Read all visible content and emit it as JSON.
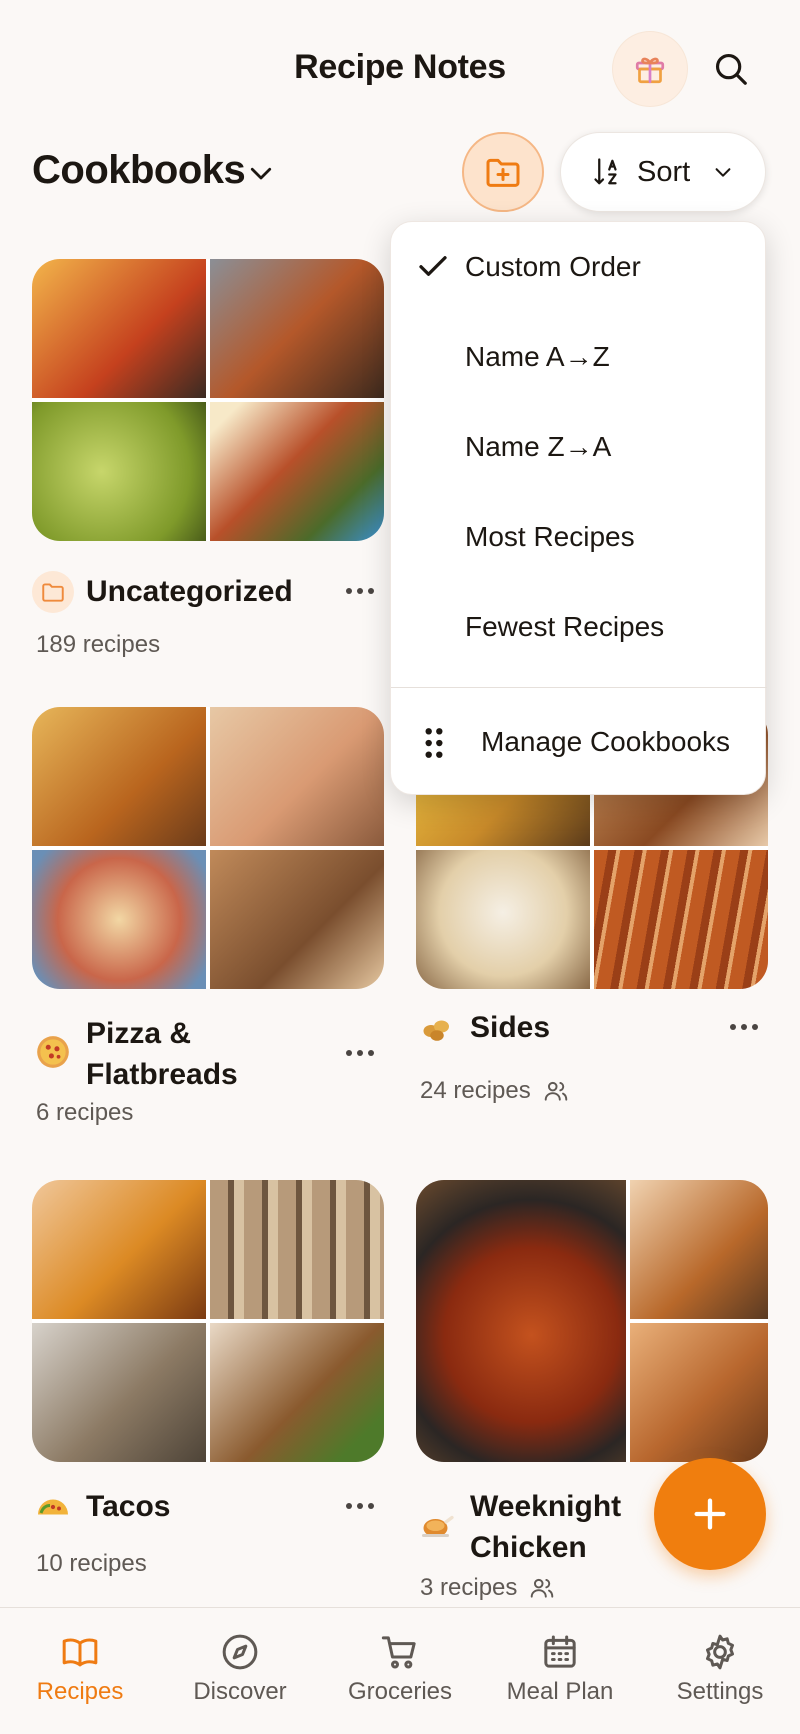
{
  "header": {
    "title": "Recipe Notes",
    "gift_icon": "gift-icon",
    "search_icon": "search-icon"
  },
  "section": {
    "title": "Cookbooks",
    "sort_label": "Sort"
  },
  "sort_menu": {
    "items": [
      {
        "label": "Custom Order",
        "selected": true
      },
      {
        "label": "Name A→Z",
        "selected": false
      },
      {
        "label": "Name Z→A",
        "selected": false
      },
      {
        "label": "Most Recipes",
        "selected": false
      },
      {
        "label": "Fewest Recipes",
        "selected": false
      }
    ],
    "manage_label": "Manage Cookbooks"
  },
  "cookbooks": [
    {
      "name": "Uncategorized",
      "count": "189 recipes",
      "icon": "folder-icon",
      "shared": false,
      "tiles": [
        "#c06a2a",
        "#7a5a3c",
        "#9fb33c",
        "#b8502a"
      ]
    },
    {
      "name": "Pizza & Flatbreads",
      "count": "6 recipes",
      "icon": "pizza-icon",
      "shared": false,
      "tiles": [
        "#c98a2c",
        "#d9a377",
        "#c9664a",
        "#b98555"
      ]
    },
    {
      "name": "Sides",
      "count": "24 recipes",
      "icon": "nuts-icon",
      "shared": true,
      "tiles": [
        "#e3b043",
        "#b3763c",
        "#e9ddc9",
        "#b6552a"
      ]
    },
    {
      "name": "Tacos",
      "count": "10 recipes",
      "icon": "taco-icon",
      "shared": false,
      "tiles": [
        "#d6842a",
        "#8c7055",
        "#9b8a77",
        "#a66a2e"
      ]
    },
    {
      "name": "Weeknight Chicken",
      "count": "3 recipes",
      "icon": "chicken-icon",
      "shared": true,
      "tiles": [
        "#b3491e",
        "#c98a55",
        "#3b302a",
        "#b86a36"
      ]
    }
  ],
  "tabs": [
    {
      "label": "Recipes",
      "icon": "book-icon",
      "active": true
    },
    {
      "label": "Discover",
      "icon": "compass-icon",
      "active": false
    },
    {
      "label": "Groceries",
      "icon": "cart-icon",
      "active": false
    },
    {
      "label": "Meal Plan",
      "icon": "calendar-icon",
      "active": false
    },
    {
      "label": "Settings",
      "icon": "gear-icon",
      "active": false
    }
  ],
  "colors": {
    "accent": "#f07e0e",
    "background": "#fbf8f6"
  }
}
